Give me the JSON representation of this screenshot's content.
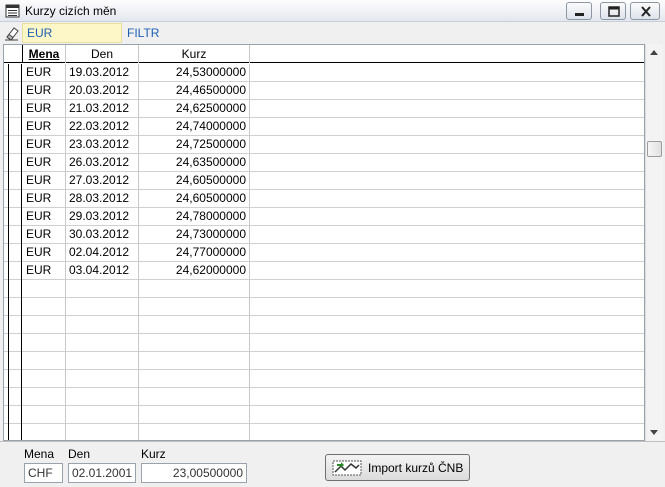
{
  "window": {
    "title": "Kurzy cizích měn"
  },
  "filter": {
    "value": "EUR",
    "label": "FILTR"
  },
  "grid": {
    "columns": [
      {
        "key": "mena",
        "label": "Mena"
      },
      {
        "key": "den",
        "label": "Den"
      },
      {
        "key": "kurz",
        "label": "Kurz"
      }
    ],
    "rows": [
      {
        "mena": "EUR",
        "den": "19.03.2012",
        "kurz": "24,53000000"
      },
      {
        "mena": "EUR",
        "den": "20.03.2012",
        "kurz": "24,46500000"
      },
      {
        "mena": "EUR",
        "den": "21.03.2012",
        "kurz": "24,62500000"
      },
      {
        "mena": "EUR",
        "den": "22.03.2012",
        "kurz": "24,74000000"
      },
      {
        "mena": "EUR",
        "den": "23.03.2012",
        "kurz": "24,72500000"
      },
      {
        "mena": "EUR",
        "den": "26.03.2012",
        "kurz": "24,63500000"
      },
      {
        "mena": "EUR",
        "den": "27.03.2012",
        "kurz": "24,60500000"
      },
      {
        "mena": "EUR",
        "den": "28.03.2012",
        "kurz": "24,60500000"
      },
      {
        "mena": "EUR",
        "den": "29.03.2012",
        "kurz": "24,78000000"
      },
      {
        "mena": "EUR",
        "den": "30.03.2012",
        "kurz": "24,73000000"
      },
      {
        "mena": "EUR",
        "den": "02.04.2012",
        "kurz": "24,77000000"
      },
      {
        "mena": "EUR",
        "den": "03.04.2012",
        "kurz": "24,62000000"
      }
    ]
  },
  "footer": {
    "mena_label": "Mena",
    "mena_value": "CHF",
    "den_label": "Den",
    "den_value": "02.01.2001",
    "kurz_label": "Kurz",
    "kurz_value": "23,00500000",
    "import_label": "Import kurzů ČNB"
  },
  "icons": {
    "app": "table-window-icon",
    "filter_clear": "eraser-icon",
    "import": "chart-import-icon"
  }
}
